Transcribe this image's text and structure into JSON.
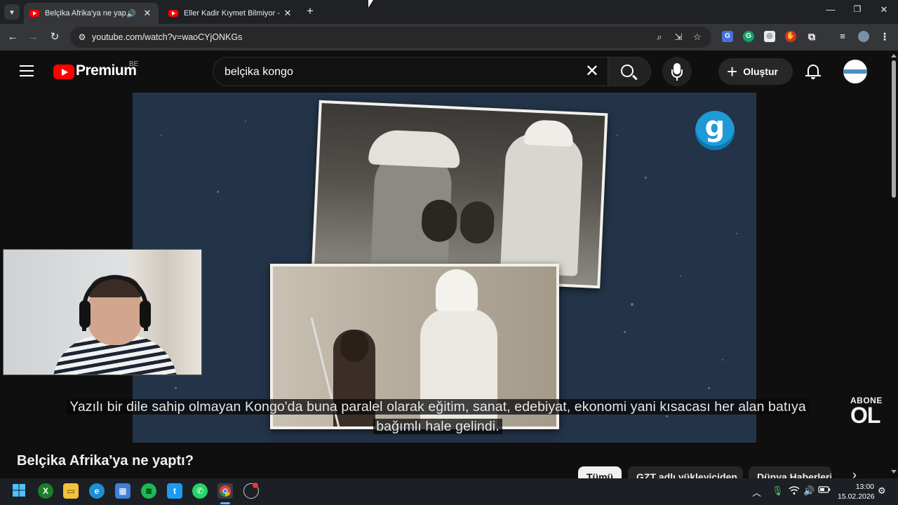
{
  "browser": {
    "tabs": [
      {
        "title": "Belçika Afrika'ya ne yaptı? -",
        "active": true,
        "audio": true
      },
      {
        "title": "Eller Kadir Kıymet Bilmiyor - Sal",
        "active": false,
        "audio": false
      }
    ],
    "url": "youtube.com/watch?v=waoCYjONKGs"
  },
  "youtube": {
    "logo_text": "Premium",
    "region": "BE",
    "search_query": "belçika kongo",
    "create_label": "Oluştur",
    "video": {
      "title": "Belçika Afrika'ya ne yaptı?",
      "caption_line1": "Yazılı bir dile sahip olmayan Kongo'da buna paralel olarak eğitim, sanat, edebiyat, ekonomi yani kısacası her alan batıya",
      "caption_line2": "bağımlı hale gelindi.",
      "watermark_letter": "g",
      "subscribe_line1": "ABONE",
      "subscribe_line2": "OL"
    },
    "chips": [
      {
        "label": "Tümü",
        "selected": true
      },
      {
        "label": "GZT adlı yükleyiciden",
        "selected": false
      },
      {
        "label": "Dünya Haberleri",
        "selected": false
      }
    ]
  },
  "taskbar": {
    "time": "13:00",
    "date": "15.02.2026"
  },
  "colors": {
    "youtube_red": "#ff0000",
    "video_bg": "#233448",
    "chip_selected": "#f1f1f1"
  }
}
